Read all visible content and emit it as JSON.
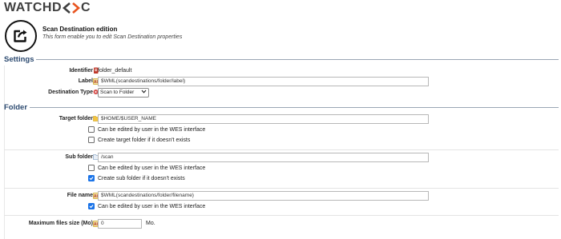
{
  "brand": {
    "prefix": "WATCHD",
    "suffix": "C"
  },
  "header": {
    "icon": "edit-square-arrow-icon",
    "title": "Scan Destination edition",
    "subtitle": "This form enable you to edit Scan Destination properties"
  },
  "settings": {
    "title": "Settings",
    "identifier": {
      "label": "Identifier",
      "value": "folder_default",
      "icon": "identifier-icon"
    },
    "label": {
      "label": "Label",
      "value": "$WML(scandestinations/folder/label)",
      "icon": "text-ab-icon"
    },
    "destination_type": {
      "label": "Destination Type",
      "value": "Scan to Folder",
      "icon": "destination-icon"
    }
  },
  "folder": {
    "title": "Folder",
    "target_folder": {
      "label": "Target folder",
      "value": "$HOME/$USER_NAME",
      "icon": "folder-icon",
      "options": [
        {
          "label": "Can be edited by user in the WES interface",
          "checked": false
        },
        {
          "label": "Create target folder if it doesn't exists",
          "checked": false
        }
      ]
    },
    "sub_folder": {
      "label": "Sub folder",
      "value": "/scan",
      "icon": "subfolder-icon",
      "options": [
        {
          "label": "Can be edited by user in the WES interface",
          "checked": false
        },
        {
          "label": "Create sub folder if it doesn't exists",
          "checked": true
        }
      ]
    },
    "file_name": {
      "label": "File name",
      "value": "$WML(scandestinations/folder/filename)",
      "icon": "text-ab-icon",
      "options": [
        {
          "label": "Can be edited by user in the WES interface",
          "checked": true
        }
      ]
    },
    "max_file_size": {
      "label": "Maximum files size (Mo)",
      "value": "0",
      "unit": "Mo.",
      "icon": "text-ab-icon"
    }
  },
  "colors": {
    "section_title": "#2c4a70",
    "checkbox_on": "#1a73e8",
    "logo_accent": "#e8541f"
  }
}
